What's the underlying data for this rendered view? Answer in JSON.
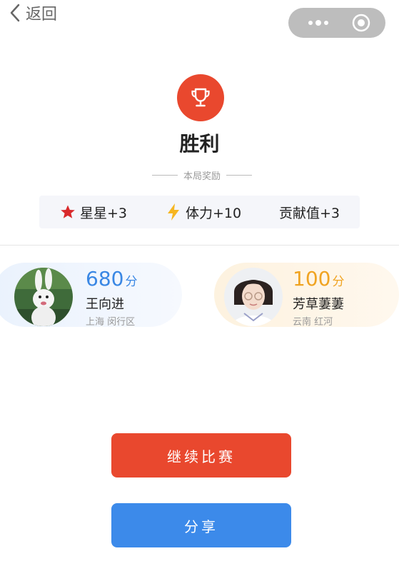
{
  "nav": {
    "back_label": "返回"
  },
  "result": {
    "title": "胜利",
    "rewards_label": "本局奖励",
    "rewards": [
      {
        "icon": "red-star-icon",
        "label": "星星+3"
      },
      {
        "icon": "lightning-icon",
        "label": "体力+10"
      },
      {
        "icon": "",
        "label": "贡献值+3"
      }
    ]
  },
  "players": [
    {
      "score": "680",
      "unit": "分",
      "name": "王向进",
      "location": "上海 闵行区",
      "score_color": "#3a87e4"
    },
    {
      "score": "100",
      "unit": "分",
      "name": "芳草萋萋",
      "location": "云南 红河",
      "score_color": "#f0a422"
    }
  ],
  "buttons": {
    "continue_label": "继续比赛",
    "share_label": "分享"
  },
  "colors": {
    "accent_red": "#e9482e",
    "accent_blue": "#3c8aea"
  }
}
